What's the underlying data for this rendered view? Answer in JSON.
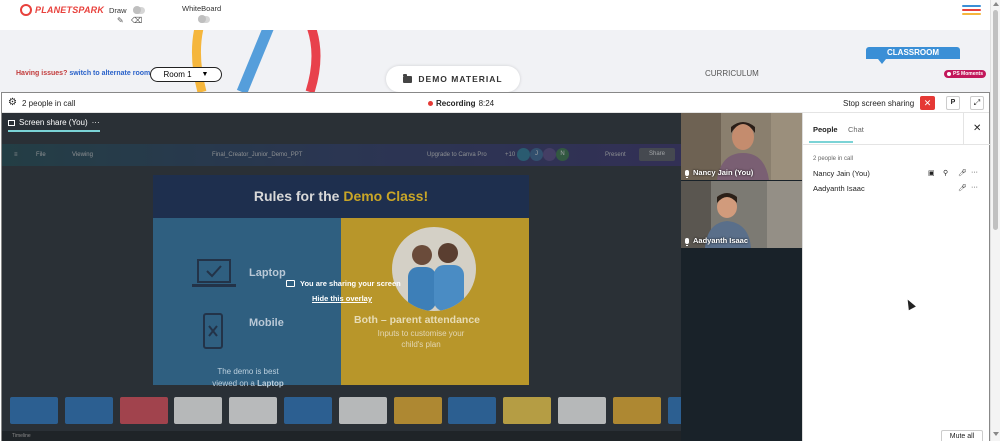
{
  "app": {
    "brand": "PLANETSPARK",
    "draw_label": "Draw",
    "whiteboard_label": "WhiteBoard",
    "hamburger_colors": [
      "#3a8fd6",
      "#e8413c",
      "#f5b63c"
    ]
  },
  "header": {
    "issue_text": "Having issues?",
    "issue_link": "switch to alternate room",
    "room_value": "Room 1",
    "demo_material": "DEMO MATERIAL",
    "curriculum": "CURRICULUM",
    "classroom": "CLASSROOM",
    "ps_moments": "PS Moments"
  },
  "callbar": {
    "people_in_call": "2 people in call",
    "recording_label": "Recording",
    "recording_time": "8:24",
    "stop_sharing": "Stop screen sharing",
    "p_label": "P"
  },
  "share": {
    "tab_label": "Screen share (You)",
    "tab_more": "···",
    "canva": {
      "file": "File",
      "viewing": "Viewing",
      "doc_title": "Final_Creator_Junior_Demo_PPT",
      "upgrade": "Upgrade to Canva Pro",
      "plus_count": "+10",
      "avatars": [
        "J",
        "N"
      ],
      "present": "Present",
      "share": "Share"
    },
    "slide": {
      "title_a": "Rules for the ",
      "title_b": "Demo Class!",
      "laptop": "Laptop",
      "mobile": "Mobile",
      "demo_best_1": "The demo is best",
      "demo_best_2": "viewed on a",
      "demo_best_3": "Laptop",
      "both": "Both – parent attendance",
      "inputs": "Inputs to customise your child's plan"
    },
    "overlay_message": "You are sharing your screen",
    "hide_overlay": "Hide this overlay",
    "thumb_colors": [
      "#2d6fb0",
      "#2d6fb0",
      "#c94a55",
      "#e6e6e6",
      "#e8e8e8",
      "#2d6fb0",
      "#e6e6e6",
      "#dba531",
      "#2d6fb0",
      "#e4c24a",
      "#e6e6e6",
      "#dba531",
      "#2d6fb0"
    ],
    "bottom_left": "Timeline"
  },
  "videos": [
    {
      "name": "Nancy Jain (You)"
    },
    {
      "name": "Aadyanth Isaac"
    }
  ],
  "panel": {
    "tab_people": "People",
    "tab_chat": "Chat",
    "count": "2 people in call",
    "participants": [
      {
        "name": "Nancy Jain (You)"
      },
      {
        "name": "Aadyanth Isaac"
      }
    ],
    "mute_all": "Mute all"
  }
}
